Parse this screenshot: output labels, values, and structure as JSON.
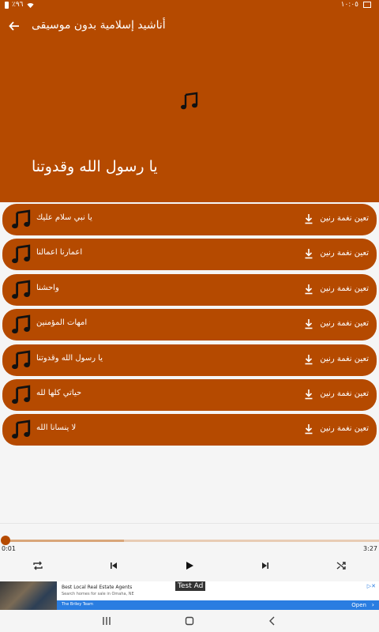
{
  "status": {
    "time": "١٠:٠٥",
    "battery": "٪٩٦"
  },
  "header": {
    "title": "أناشيد إسلامية بدون موسيقى",
    "back_icon": "arrow-back-icon"
  },
  "hero": {
    "now_playing": "يا رسول الله وقدوتنا",
    "icon": "music-note-icon"
  },
  "list": {
    "ringtone_label": "تعين نغمة رنين",
    "items": [
      {
        "title": "يا نبي سلام عليك"
      },
      {
        "title": "اعمارنا اعمالنا"
      },
      {
        "title": "واحشنا"
      },
      {
        "title": "امهات المؤمنين"
      },
      {
        "title": "يا رسول الله وقدوتنا"
      },
      {
        "title": "حياتي كلها لله"
      },
      {
        "title": "لا ينسانا الله"
      }
    ]
  },
  "player": {
    "current_time": "0:01",
    "total_time": "3:27",
    "progress": 0.005,
    "buffered": 0.32,
    "icons": [
      "repeat-icon",
      "previous-icon",
      "play-icon",
      "next-icon",
      "shuffle-icon"
    ]
  },
  "ad": {
    "label": "Test Ad",
    "title": "Best Local Real Estate Agents",
    "subtitle": "Search homes for sale in Omaha, NE",
    "team": "The Briley Team",
    "open": "Open"
  },
  "colors": {
    "primary": "#b54a00",
    "background": "#f5f5f5",
    "ad_blue": "#2a7de1"
  }
}
